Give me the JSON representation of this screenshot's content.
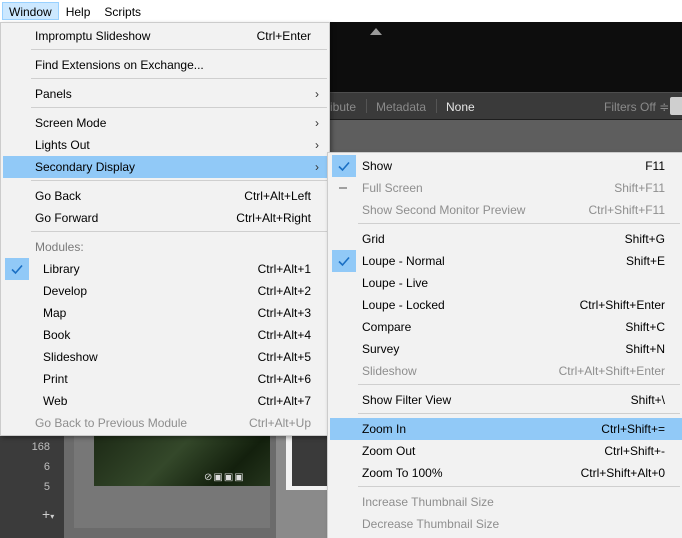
{
  "menubar": {
    "items": [
      {
        "label": "Window",
        "active": true
      },
      {
        "label": "Help",
        "active": false
      },
      {
        "label": "Scripts",
        "active": false
      }
    ]
  },
  "background": {
    "filterbar": {
      "attribute_label": "ibute",
      "metadata_label": "Metadata",
      "none_label": "None",
      "filters_label": "Filters Off ≑"
    },
    "left_counts": [
      "168",
      "6",
      "5"
    ],
    "add_icon": "plus-icon"
  },
  "window_menu": {
    "items": [
      {
        "label": "Impromptu Slideshow",
        "shortcut": "Ctrl+Enter"
      },
      {
        "label": "Find Extensions on Exchange..."
      },
      {
        "label": "Panels",
        "submenu": true
      },
      {
        "label": "Screen Mode",
        "submenu": true
      },
      {
        "label": "Lights Out",
        "submenu": true
      },
      {
        "label": "Secondary Display",
        "submenu": true,
        "highlighted": true
      },
      {
        "label": "Go Back",
        "shortcut": "Ctrl+Alt+Left"
      },
      {
        "label": "Go Forward",
        "shortcut": "Ctrl+Alt+Right"
      },
      {
        "label": "Modules:",
        "section": true
      },
      {
        "label": "Library",
        "shortcut": "Ctrl+Alt+1",
        "checked": true
      },
      {
        "label": "Develop",
        "shortcut": "Ctrl+Alt+2"
      },
      {
        "label": "Map",
        "shortcut": "Ctrl+Alt+3"
      },
      {
        "label": "Book",
        "shortcut": "Ctrl+Alt+4"
      },
      {
        "label": "Slideshow",
        "shortcut": "Ctrl+Alt+5"
      },
      {
        "label": "Print",
        "shortcut": "Ctrl+Alt+6"
      },
      {
        "label": "Web",
        "shortcut": "Ctrl+Alt+7"
      },
      {
        "label": "Go Back to Previous Module",
        "shortcut": "Ctrl+Alt+Up",
        "disabled": true
      }
    ]
  },
  "secondary_display_menu": {
    "items": [
      {
        "label": "Show",
        "shortcut": "F11",
        "checked": true
      },
      {
        "label": "Full Screen",
        "shortcut": "Shift+F11",
        "disabled": true,
        "indeterminate": true
      },
      {
        "label": "Show Second Monitor Preview",
        "shortcut": "Ctrl+Shift+F11",
        "disabled": true
      },
      {
        "label": "Grid",
        "shortcut": "Shift+G"
      },
      {
        "label": "Loupe - Normal",
        "shortcut": "Shift+E",
        "checked": true
      },
      {
        "label": "Loupe - Live"
      },
      {
        "label": "Loupe - Locked",
        "shortcut": "Ctrl+Shift+Enter"
      },
      {
        "label": "Compare",
        "shortcut": "Shift+C"
      },
      {
        "label": "Survey",
        "shortcut": "Shift+N"
      },
      {
        "label": "Slideshow",
        "shortcut": "Ctrl+Alt+Shift+Enter",
        "disabled": true
      },
      {
        "label": "Show Filter View",
        "shortcut": "Shift+\\"
      },
      {
        "label": "Zoom In",
        "shortcut": "Ctrl+Shift+=",
        "highlighted": true
      },
      {
        "label": "Zoom Out",
        "shortcut": "Ctrl+Shift+-"
      },
      {
        "label": "Zoom To 100%",
        "shortcut": "Ctrl+Shift+Alt+0"
      },
      {
        "label": "Increase Thumbnail Size",
        "disabled": true
      },
      {
        "label": "Decrease Thumbnail Size",
        "disabled": true
      }
    ]
  },
  "colors": {
    "highlight": "#91c9f7",
    "menu_bg": "#f2f2f2",
    "check": "#1a6fc4",
    "disabled_text": "#8e8e8e"
  }
}
